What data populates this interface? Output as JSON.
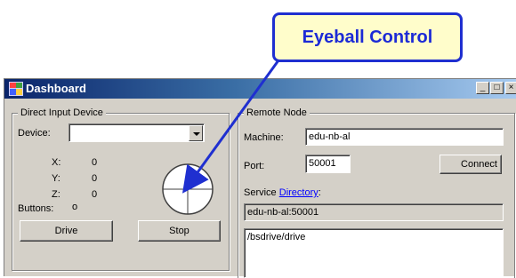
{
  "callout": {
    "label": "Eyeball Control"
  },
  "window": {
    "title": "Dashboard",
    "controls": {
      "minimize": "_",
      "maximize": "□",
      "close": "×"
    }
  },
  "direct_input": {
    "group_label": "Direct Input Device",
    "device_label": "Device:",
    "device_value": "",
    "x_label": "X:",
    "x_value": "0",
    "y_label": "Y:",
    "y_value": "0",
    "z_label": "Z:",
    "z_value": "0",
    "buttons_label": "Buttons:",
    "buttons_value": "o",
    "drive_button": "Drive",
    "stop_button": "Stop"
  },
  "remote_node": {
    "group_label": "Remote Node",
    "machine_label": "Machine:",
    "machine_value": "edu-nb-al",
    "port_label": "Port:",
    "port_value": "50001",
    "connect_button": "Connect",
    "service_label": "Service",
    "directory_link": "Directory",
    "colon": ":",
    "service_address": "edu-nb-al:50001",
    "service_list": [
      "/bsdrive/drive"
    ]
  },
  "colors": {
    "accent": "#1f2fd0",
    "callout_bg": "#fffdcb",
    "window_bg": "#d4d0c8",
    "title_start": "#0a246a",
    "title_end": "#a6caf0"
  }
}
